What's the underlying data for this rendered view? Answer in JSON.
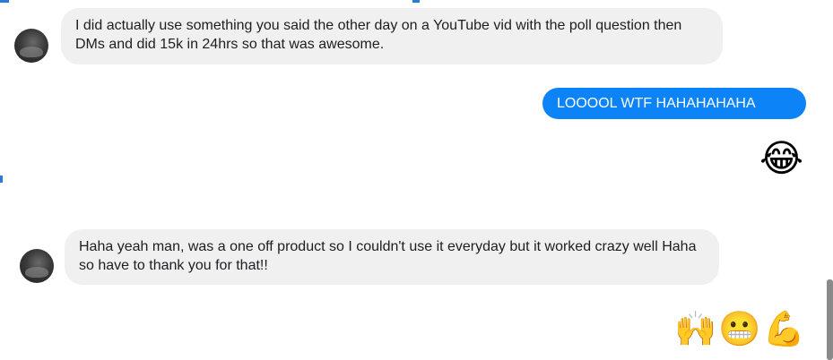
{
  "conversation": {
    "messages": [
      {
        "sender": "them",
        "text": "I did actually use something you said the other day on a YouTube vid with the poll question then DMs and did 15k in 24hrs so that was awesome."
      },
      {
        "sender": "me",
        "text": "LOOOOL WTF HAHAHAHAHA"
      },
      {
        "sender": "me",
        "emoji": "😂",
        "emoji_name": "face-with-tears-of-joy-icon"
      },
      {
        "sender": "them",
        "text": "Haha yeah man, was a one off product so I couldn't use it everyday but it worked crazy well Haha so have to thank you for that!!"
      },
      {
        "sender": "me",
        "emojis": [
          "🙌",
          "😬",
          "💪"
        ],
        "emoji_names": [
          "raising-hands-icon",
          "grimacing-face-icon",
          "flexed-biceps-icon"
        ]
      }
    ]
  },
  "colors": {
    "outgoing_bubble": "#0c84f7",
    "incoming_bubble": "#f1f0f0",
    "accent_marks": "#2b7bd8"
  }
}
